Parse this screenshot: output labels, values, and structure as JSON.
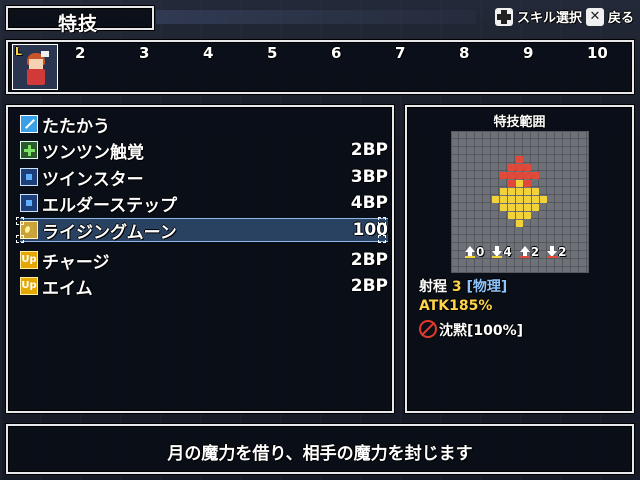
{
  "header": {
    "title": "特技",
    "hint_select_icon": "dpad-icon",
    "hint_select": "スキル選択",
    "hint_back_icon": "x-button-icon",
    "hint_back": "戻る"
  },
  "party": {
    "selected_slot_label": "L",
    "slots": [
      "2",
      "3",
      "4",
      "5",
      "6",
      "7",
      "8",
      "9",
      "10"
    ]
  },
  "skills": [
    {
      "icon": "sword-icon",
      "name": "たたかう",
      "cost": ""
    },
    {
      "icon": "green-plus-icon",
      "name": "ツンツン触覚",
      "cost": "2BP"
    },
    {
      "icon": "blue-square-icon",
      "name": "ツインスター",
      "cost": "3BP"
    },
    {
      "icon": "blue-square-icon",
      "name": "エルダーステップ",
      "cost": "4BP"
    },
    {
      "icon": "moon-icon",
      "name": "ライジングムーン",
      "cost": "100"
    },
    {
      "icon": "up-icon",
      "name": "チャージ",
      "cost": "2BP"
    },
    {
      "icon": "up-icon",
      "name": "エイム",
      "cost": "2BP"
    }
  ],
  "selected_skill_index": 4,
  "range_panel": {
    "title": "特技範囲",
    "directions": [
      {
        "icon": "arrow-up-yellow-icon",
        "value": "0"
      },
      {
        "icon": "arrow-down-yellow-icon",
        "value": "4"
      },
      {
        "icon": "arrow-up-red-icon",
        "value": "2"
      },
      {
        "icon": "arrow-down-red-icon",
        "value": "2"
      }
    ],
    "range_label": "射程",
    "range_value": "3",
    "range_type": "[物理]",
    "atk": "ATK185%",
    "status_icon": "silence-icon",
    "status": "沈黙[100%]",
    "colors": {
      "red": "#e04a3a",
      "yellow": "#f2d23a",
      "grid": "#55585e"
    }
  },
  "description": "月の魔力を借り、相手の魔力を封じます"
}
